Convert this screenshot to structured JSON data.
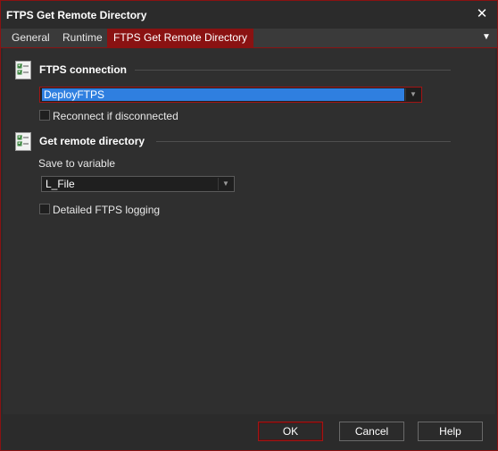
{
  "window": {
    "title": "FTPS Get Remote Directory",
    "close_glyph": "✕"
  },
  "tabs": [
    {
      "label": "General",
      "active": false
    },
    {
      "label": "Runtime",
      "active": false
    },
    {
      "label": "FTPS Get Remote Directory",
      "active": true
    }
  ],
  "tab_menu_glyph": "▼",
  "sections": {
    "connection": {
      "title": "FTPS connection",
      "icon": "checklist-icon",
      "combo_value": "DeployFTPS",
      "reconnect_label": "Reconnect if disconnected",
      "reconnect_checked": false
    },
    "remote": {
      "title": "Get remote directory",
      "icon": "checklist-icon",
      "save_label": "Save to variable",
      "save_value": "L_File",
      "logging_label": "Detailed FTPS logging",
      "logging_checked": false
    }
  },
  "dropdown_arrow": "▼",
  "buttons": {
    "ok": "OK",
    "cancel": "Cancel",
    "help": "Help"
  },
  "colors": {
    "accent": "#8a1212",
    "selection": "#2f7fe0",
    "background": "#2b2b2b"
  }
}
